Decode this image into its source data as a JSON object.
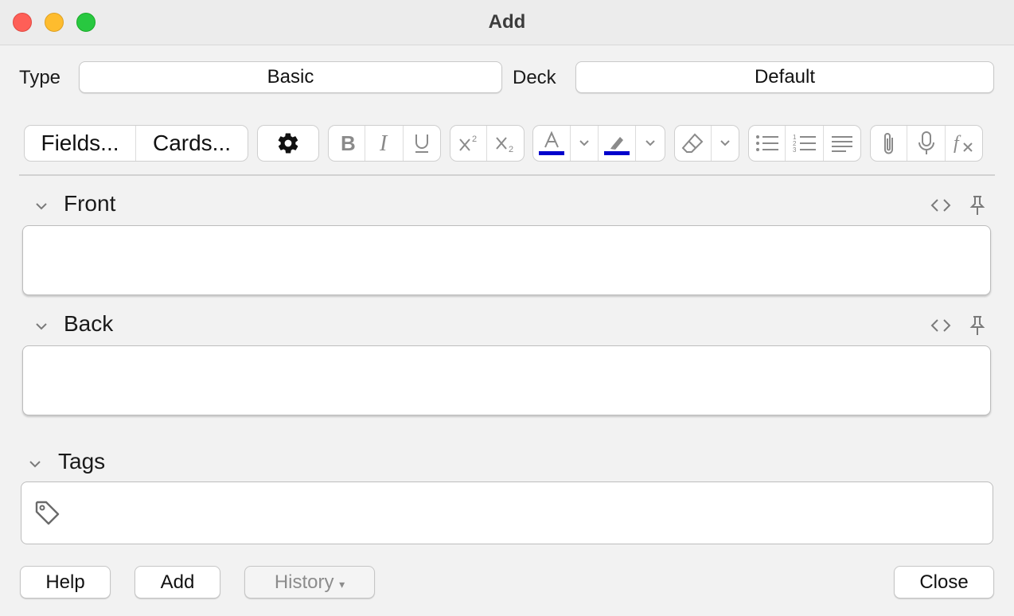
{
  "window": {
    "title": "Add"
  },
  "header": {
    "type_label": "Type",
    "type_value": "Basic",
    "deck_label": "Deck",
    "deck_value": "Default"
  },
  "toolbar": {
    "fields_label": "Fields...",
    "cards_label": "Cards...",
    "icons": [
      "gear-icon",
      "bold-icon",
      "italic-icon",
      "underline-icon",
      "superscript-icon",
      "subscript-icon",
      "text-color-icon",
      "highlight-icon",
      "eraser-icon",
      "bulleted-list-icon",
      "numbered-list-icon",
      "align-icon",
      "attachment-icon",
      "microphone-icon",
      "function-icon"
    ],
    "colors": {
      "text_color": "#0000cc",
      "highlight_color": "#0000cc"
    }
  },
  "fields": [
    {
      "name": "Front",
      "value": ""
    },
    {
      "name": "Back",
      "value": ""
    }
  ],
  "tags": {
    "label": "Tags",
    "value": ""
  },
  "buttons": {
    "help": "Help",
    "add": "Add",
    "history": "History",
    "history_arrow": "▾",
    "close": "Close"
  }
}
